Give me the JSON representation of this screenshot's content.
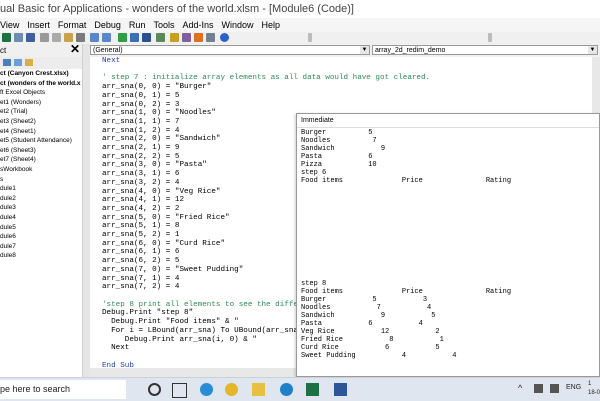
{
  "window": {
    "title": "ual Basic for Applications - wonders of the world.xlsm - [Module6 (Code)]"
  },
  "menu": [
    "View",
    "Insert",
    "Format",
    "Debug",
    "Run",
    "Tools",
    "Add-Ins",
    "Window",
    "Help"
  ],
  "project": {
    "header": "ct",
    "close_glyph": "✕",
    "tree": [
      {
        "text": "ct (Canyon Crest.xlsx)",
        "bold": true
      },
      {
        "text": "ct (wonders of the world.x",
        "bold": true
      },
      {
        "text": "ft Excel Objects",
        "bold": false
      },
      {
        "text": "et1 (Wonders)",
        "bold": false
      },
      {
        "text": "et2 (Trial)",
        "bold": false
      },
      {
        "text": "et3 (Sheet2)",
        "bold": false
      },
      {
        "text": "et4 (Sheet1)",
        "bold": false
      },
      {
        "text": "et5 (Student Attendance)",
        "bold": false
      },
      {
        "text": "et6 (Sheet3)",
        "bold": false
      },
      {
        "text": "et7 (Sheet4)",
        "bold": false
      },
      {
        "text": "sWorkbook",
        "bold": false
      },
      {
        "text": "s",
        "bold": false
      },
      {
        "text": "dule1",
        "bold": false
      },
      {
        "text": "dule2",
        "bold": false
      },
      {
        "text": "dule3",
        "bold": false
      },
      {
        "text": "dule4",
        "bold": false
      },
      {
        "text": "dule5",
        "bold": false
      },
      {
        "text": "dule6",
        "bold": false
      },
      {
        "text": "dule7",
        "bold": false
      },
      {
        "text": "dule8",
        "bold": false
      }
    ]
  },
  "code_header": {
    "object_combo": "(General)",
    "procedure_combo": "array_2d_redim_demo"
  },
  "code_lines": [
    {
      "t": "Next",
      "k": "kw"
    },
    {
      "t": "",
      "k": "code"
    },
    {
      "t": "' step 7 : initialize array elements as all data would have got cleared.",
      "k": "comment"
    },
    {
      "t": "arr_sna(0, 0) = \"Burger\"",
      "k": "code"
    },
    {
      "t": "arr_sna(0, 1) = 5",
      "k": "code"
    },
    {
      "t": "arr_sna(0, 2) = 3",
      "k": "code"
    },
    {
      "t": "arr_sna(1, 0) = \"Noodles\"",
      "k": "code"
    },
    {
      "t": "arr_sna(1, 1) = 7",
      "k": "code"
    },
    {
      "t": "arr_sna(1, 2) = 4",
      "k": "code"
    },
    {
      "t": "arr_sna(2, 0) = \"Sandwich\"",
      "k": "code"
    },
    {
      "t": "arr_sna(2, 1) = 9",
      "k": "code"
    },
    {
      "t": "arr_sna(2, 2) = 5",
      "k": "code"
    },
    {
      "t": "arr_sna(3, 0) = \"Pasta\"",
      "k": "code"
    },
    {
      "t": "arr_sna(3, 1) = 6",
      "k": "code"
    },
    {
      "t": "arr_sna(3, 2) = 4",
      "k": "code"
    },
    {
      "t": "arr_sna(4, 0) = \"Veg Rice\"",
      "k": "code"
    },
    {
      "t": "arr_sna(4, 1) = 12",
      "k": "code"
    },
    {
      "t": "arr_sna(4, 2) = 2",
      "k": "code"
    },
    {
      "t": "arr_sna(5, 0) = \"Fried Rice\"",
      "k": "code"
    },
    {
      "t": "arr_sna(5, 1) = 8",
      "k": "code"
    },
    {
      "t": "arr_sna(5, 2) = 1",
      "k": "code"
    },
    {
      "t": "arr_sna(6, 0) = \"Curd Rice\"",
      "k": "code"
    },
    {
      "t": "arr_sna(6, 1) = 6",
      "k": "code"
    },
    {
      "t": "arr_sna(6, 2) = 5",
      "k": "code"
    },
    {
      "t": "arr_sna(7, 0) = \"Sweet Pudding\"",
      "k": "code"
    },
    {
      "t": "arr_sna(7, 1) = 4",
      "k": "code"
    },
    {
      "t": "arr_sna(7, 2) = 4",
      "k": "code"
    },
    {
      "t": "",
      "k": "code"
    },
    {
      "t": "'step 8 print all elements to see the differ",
      "k": "comment"
    },
    {
      "t": "Debug.Print \"step 8\"",
      "k": "code"
    },
    {
      "t": "  Debug.Print \"Food items\" & \"",
      "k": "code"
    },
    {
      "t": "  For i = LBound(arr_sna) To UBound(arr_sna)",
      "k": "code"
    },
    {
      "t": "     Debug.Print arr_sna(i, 0) & \"",
      "k": "code"
    },
    {
      "t": "  Next",
      "k": "code"
    },
    {
      "t": "",
      "k": "code"
    },
    {
      "t": "End Sub",
      "k": "kw"
    }
  ],
  "immediate": {
    "title": "Immediate",
    "lines": [
      "Burger          5",
      "Noodles          7",
      "Sandwich           9",
      "Pasta           6",
      "Pizza           10",
      "step 6",
      "Food items              Price               Rating",
      "",
      "",
      "",
      "",
      "",
      "",
      "",
      "",
      "",
      "",
      "",
      "",
      "step 8",
      "Food items              Price               Rating",
      "Burger           5           3",
      "Noodles           7           4",
      "Sandwich           9           5",
      "Pasta           6           4",
      "Veg Rice           12           2",
      "Fried Rice           8           1",
      "Curd Rice           6           5",
      "Sweet Pudding           4           4"
    ]
  },
  "taskbar": {
    "search_text": "pe here to search",
    "tray_arrow": "^",
    "language": "ENG",
    "clock_time": "1",
    "clock_date": "18-0"
  }
}
